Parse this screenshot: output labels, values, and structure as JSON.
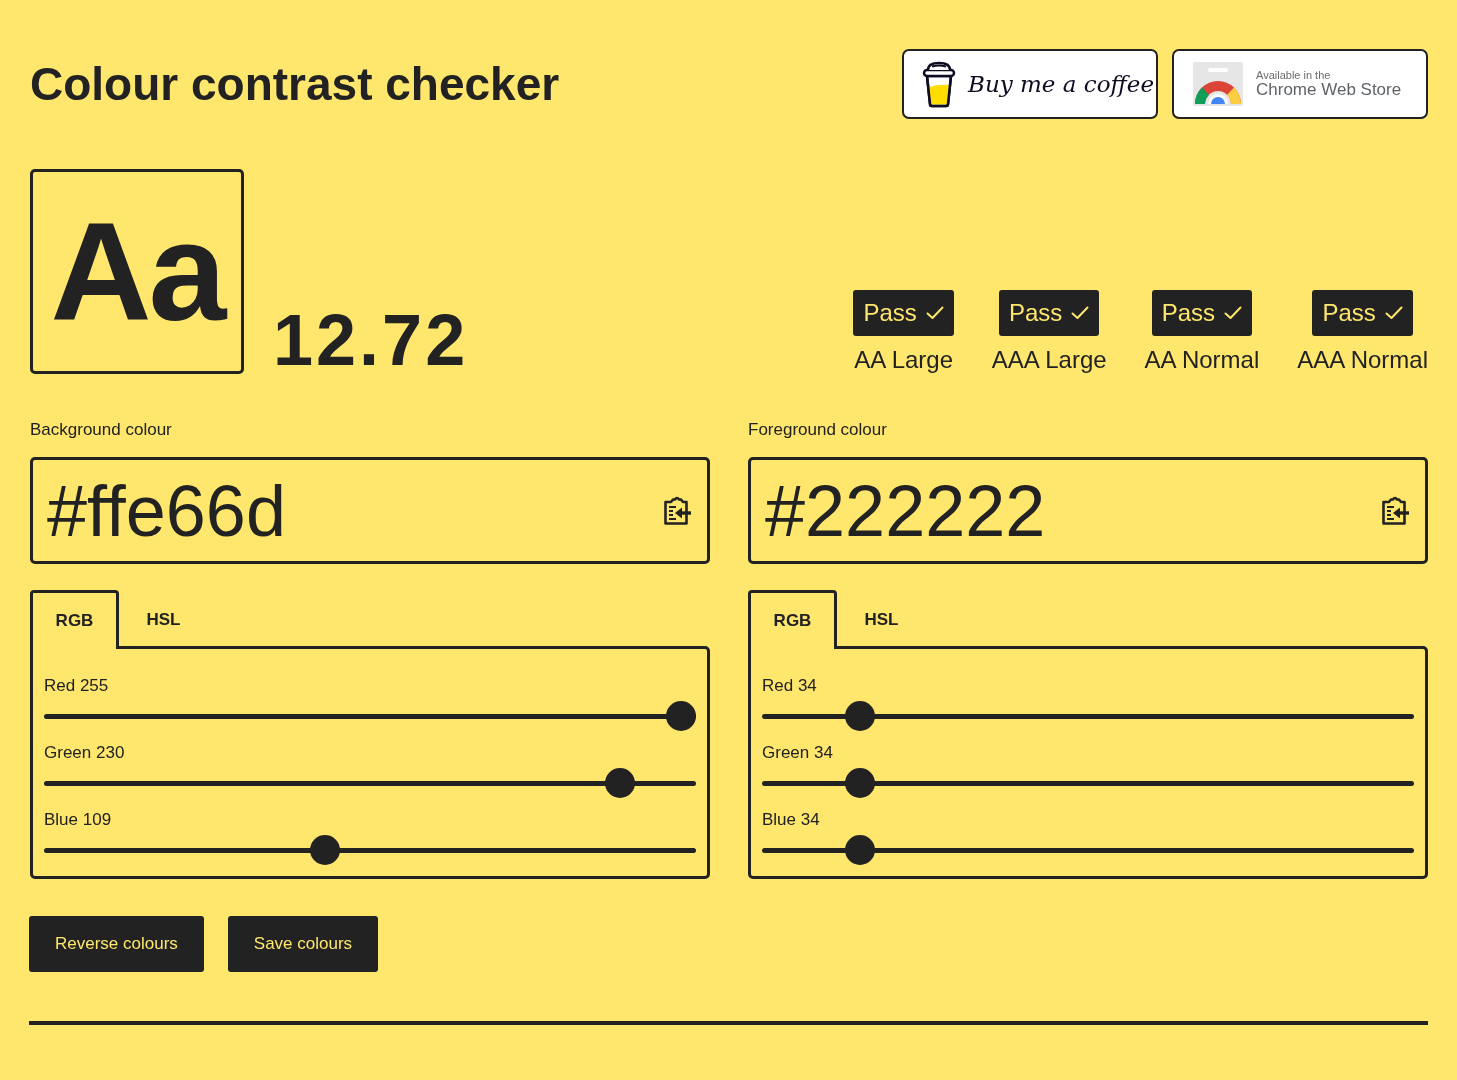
{
  "header": {
    "title": "Colour contrast checker",
    "links": [
      {
        "kind": "coffee",
        "label": "Buy me a coffee"
      },
      {
        "kind": "store",
        "caption": "Available in the",
        "label": "Chrome Web Store"
      }
    ]
  },
  "preview": {
    "sample": "Aa",
    "ratio": "12.72"
  },
  "results": [
    {
      "badge": "Pass",
      "passed": true,
      "label": "AA Large"
    },
    {
      "badge": "Pass",
      "passed": true,
      "label": "AAA Large"
    },
    {
      "badge": "Pass",
      "passed": true,
      "label": "AA Normal"
    },
    {
      "badge": "Pass",
      "passed": true,
      "label": "AAA Normal"
    }
  ],
  "colours": [
    {
      "label": "Background colour",
      "value": "#ffe66d",
      "tabs": [
        {
          "label": "RGB",
          "selected": true
        },
        {
          "label": "HSL",
          "selected": false
        }
      ],
      "sliders": [
        {
          "label": "Red 255",
          "level": 1
        },
        {
          "label": "Green 230",
          "level": 0.902
        },
        {
          "label": "Blue 109",
          "level": 0.427
        }
      ]
    },
    {
      "label": "Foreground colour",
      "value": "#222222",
      "tabs": [
        {
          "label": "RGB",
          "selected": true
        },
        {
          "label": "HSL",
          "selected": false
        }
      ],
      "sliders": [
        {
          "label": "Red 34",
          "level": 0.133
        },
        {
          "label": "Green 34",
          "level": 0.133
        },
        {
          "label": "Blue 34",
          "level": 0.133
        }
      ]
    }
  ],
  "actions": [
    "Reverse colours",
    "Save colours"
  ]
}
